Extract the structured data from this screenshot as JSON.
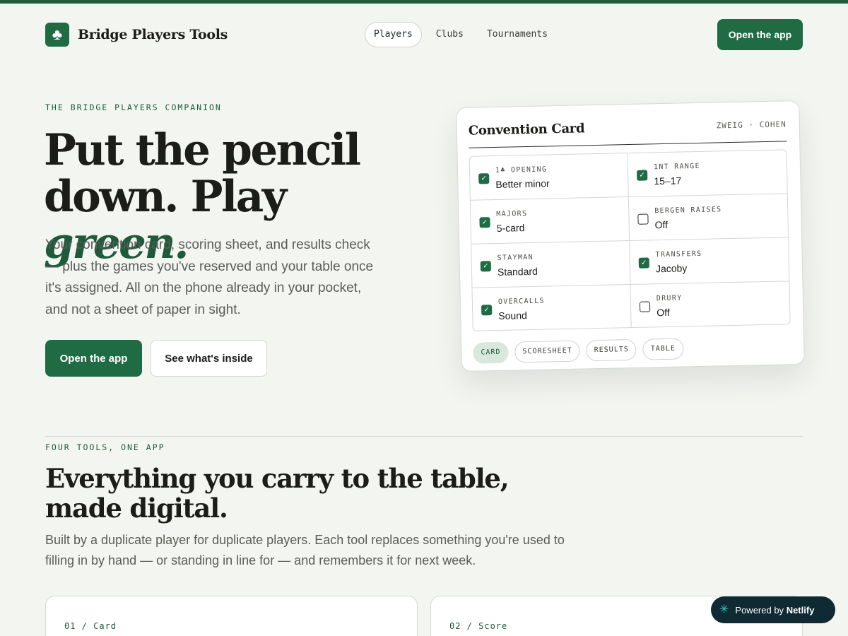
{
  "brand": {
    "name": "Bridge Players Tools",
    "logo_icon": "club-suit-icon",
    "logo_glyph": "♣",
    "accent": "#1f6b44"
  },
  "nav": {
    "items": [
      "Players",
      "Clubs",
      "Tournaments"
    ],
    "active": "Players"
  },
  "header": {
    "cta": "Open the app"
  },
  "hero": {
    "eyebrow": "THE BRIDGE PLAYERS COMPANION",
    "title_line1": "Put the pencil",
    "title_line2_prefix": "down. Play ",
    "title_emphasis": "green.",
    "description": "Your convention card, scoring sheet, and results check — plus the games you've reserved and your table once it's assigned. All on the phone already in your pocket, and not a sheet of paper in sight.",
    "primary_cta": "Open the app",
    "secondary_cta": "See what's inside"
  },
  "card": {
    "title": "Convention Card",
    "players": "ZWEIG · COHEN",
    "fields": [
      {
        "label": "1♣ OPENING",
        "value": "Better minor",
        "checked": true
      },
      {
        "label": "1NT RANGE",
        "value": "15–17",
        "checked": true
      },
      {
        "label": "MAJORS",
        "value": "5-card",
        "checked": true
      },
      {
        "label": "BERGEN RAISES",
        "value": "Off",
        "checked": false
      },
      {
        "label": "STAYMAN",
        "value": "Standard",
        "checked": true
      },
      {
        "label": "TRANSFERS",
        "value": "Jacoby",
        "checked": true
      },
      {
        "label": "OVERCALLS",
        "value": "Sound",
        "checked": true
      },
      {
        "label": "DRURY",
        "value": "Off",
        "checked": false
      }
    ],
    "tabs": [
      "CARD",
      "SCORESHEET",
      "RESULTS",
      "TABLE"
    ],
    "active_tab": "CARD"
  },
  "section": {
    "eyebrow": "FOUR TOOLS, ONE APP",
    "title": "Everything you carry to the table, made digital.",
    "description": "Built by a duplicate player for duplicate players. Each tool replaces something you're used to filling in by hand — or standing in line for — and remembers it for next week.",
    "tools": [
      "01 / Card",
      "02 / Score"
    ]
  },
  "badge": {
    "prefix": "Powered by",
    "name": "Netlify",
    "icon": "netlify-icon"
  }
}
